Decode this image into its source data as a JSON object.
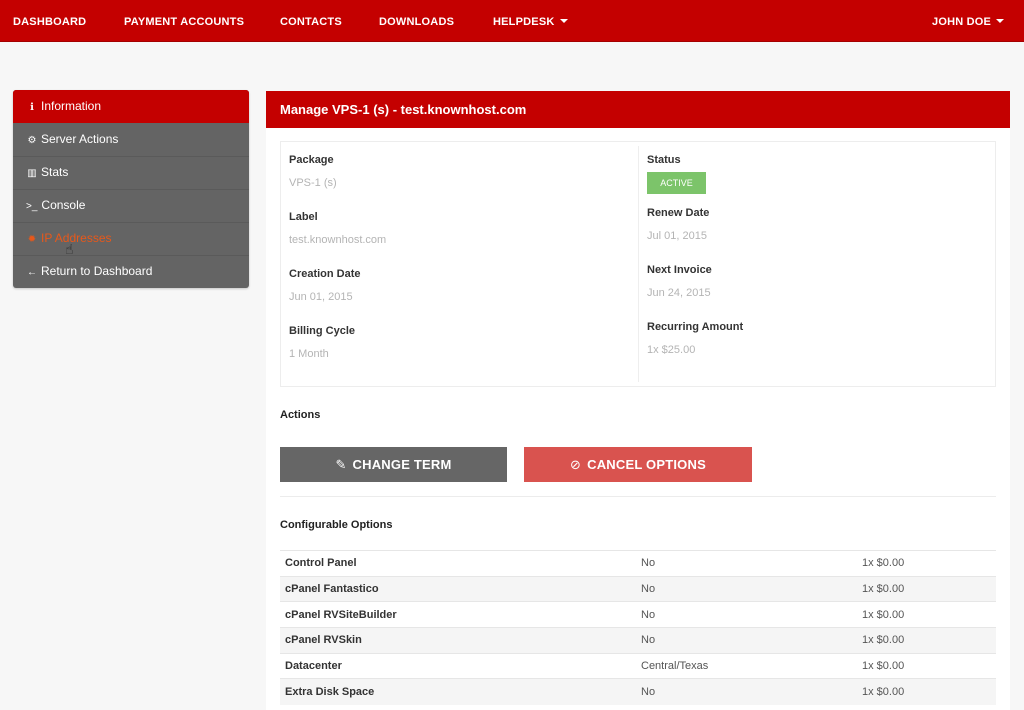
{
  "nav": {
    "dashboard": "DASHBOARD",
    "payment_accounts": "PAYMENT ACCOUNTS",
    "contacts": "CONTACTS",
    "downloads": "DOWNLOADS",
    "helpdesk": "HELPDESK",
    "user": "JOHN DOE"
  },
  "sidebar": {
    "items": [
      {
        "label": "Information",
        "icon": "info-circle-icon",
        "glyph": "ℹ"
      },
      {
        "label": "Server Actions",
        "icon": "gears-icon",
        "glyph": "⚙"
      },
      {
        "label": "Stats",
        "icon": "bar-chart-icon",
        "glyph": "▥"
      },
      {
        "label": "Console",
        "icon": "terminal-icon",
        "glyph": ">_"
      },
      {
        "label": "IP Addresses",
        "icon": "settings-icon",
        "glyph": "✹"
      },
      {
        "label": "Return to Dashboard",
        "icon": "arrow-left-icon",
        "glyph": "←"
      }
    ]
  },
  "main": {
    "title": "Manage VPS-1 (s) - test.knownhost.com",
    "package_label": "Package",
    "package_value": "VPS-1 (s)",
    "label_label": "Label",
    "label_value": "test.knownhost.com",
    "creation_label": "Creation Date",
    "creation_value": "Jun 01, 2015",
    "billing_label": "Billing Cycle",
    "billing_value": "1 Month",
    "status_label": "Status",
    "status_value": "ACTIVE",
    "renew_label": "Renew Date",
    "renew_value": "Jul 01, 2015",
    "next_invoice_label": "Next Invoice",
    "next_invoice_value": "Jun 24, 2015",
    "recurring_label": "Recurring Amount",
    "recurring_value": "1x $25.00",
    "actions_title": "Actions",
    "change_term": "CHANGE TERM",
    "cancel_options": "CANCEL OPTIONS",
    "config_title": "Configurable Options",
    "options": [
      {
        "name": "Control Panel",
        "value": "No",
        "price": "1x $0.00"
      },
      {
        "name": "cPanel Fantastico",
        "value": "No",
        "price": "1x $0.00"
      },
      {
        "name": "cPanel RVSiteBuilder",
        "value": "No",
        "price": "1x $0.00"
      },
      {
        "name": "cPanel RVSkin",
        "value": "No",
        "price": "1x $0.00"
      },
      {
        "name": "Datacenter",
        "value": "Central/Texas",
        "price": "1x $0.00"
      },
      {
        "name": "Extra Disk Space",
        "value": "No",
        "price": "1x $0.00"
      }
    ]
  },
  "colors": {
    "brand_red": "#c40000",
    "sidebar_gray": "#646464",
    "status_green": "#7cc46a",
    "cancel_red": "#d9534f",
    "highlight_orange": "#e8581a"
  }
}
